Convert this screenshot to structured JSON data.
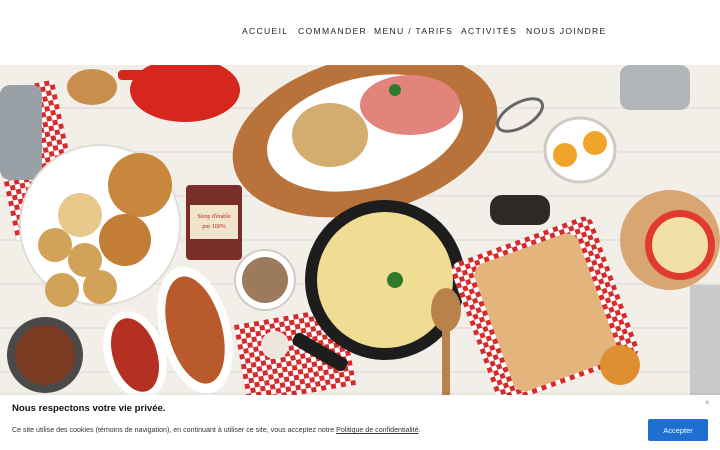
{
  "nav": {
    "items": [
      {
        "label": "ACCUEIL"
      },
      {
        "label": "COMMANDER"
      },
      {
        "label": "MENU / TARIFS"
      },
      {
        "label": "ACTIVITÉS"
      },
      {
        "label": "NOUS JOINDRE"
      }
    ]
  },
  "hero": {
    "can_label_line1": "Sirop d'érable",
    "can_label_line2": "pur 100%"
  },
  "cookie": {
    "title": "Nous respectons votre vie privée.",
    "text_before": "Ce site utilise des cookies (témoins de navigation), en continuant à utiliser ce site, vous acceptez notre ",
    "link_text": "Politique de confidentialité",
    "text_after": ".",
    "accept_label": "Accepter",
    "close_glyph": "×"
  },
  "colors": {
    "accent": "#1e6fd1",
    "checkered": "#d72b2b"
  }
}
